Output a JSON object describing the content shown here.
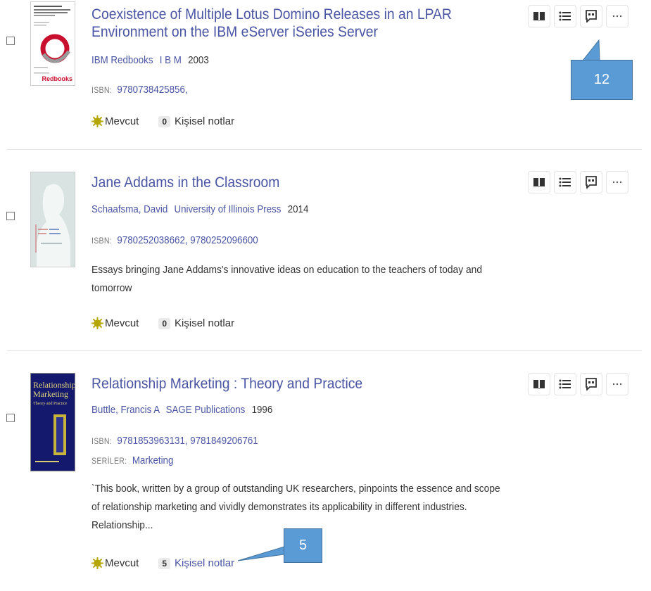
{
  "records": [
    {
      "title": "Coexistence of Multiple Lotus Domino Releases in an LPAR Environment on the IBM eServer iSeries Server",
      "author": "IBM Redbooks",
      "publisher": "I B M",
      "year": "2003",
      "isbn_label": "ISBN:",
      "isbn": "9780738425856,",
      "availability": "Mevcut",
      "notes_count": "0",
      "notes_label": "Kişisel notlar",
      "cover_text": "Redbooks"
    },
    {
      "title": "Jane Addams in the Classroom",
      "author": "Schaafsma, David",
      "publisher": "University of Illinois Press",
      "year": "2014",
      "isbn_label": "ISBN:",
      "isbn": "9780252038662, 9780252096600",
      "description": "Essays bringing Jane Addams's innovative ideas on education to the teachers of today and tomorrow",
      "availability": "Mevcut",
      "notes_count": "0",
      "notes_label": "Kişisel notlar"
    },
    {
      "title": "Relationship Marketing : Theory and Practice",
      "author": "Buttle, Francis A",
      "publisher": "SAGE Publications",
      "year": "1996",
      "isbn_label": "ISBN:",
      "isbn": "9781853963131, 9781849206761",
      "series_label": "SERİLER:",
      "series": "Marketing",
      "description": "`This book, written by a group of outstanding UK researchers, pinpoints the essence and scope of relationship marketing and vividly demonstrates its applicability in different industries. Relationship...",
      "availability": "Mevcut",
      "notes_count": "5",
      "notes_label": "Kişisel notlar",
      "cover_title": "Relationship Marketing",
      "cover_subtitle": "Theory and Practice"
    }
  ],
  "callouts": [
    {
      "label": "12"
    },
    {
      "label": "5"
    }
  ],
  "icons": [
    "book-icon",
    "list-icon",
    "quote-icon",
    "more-icon",
    "availability-icon"
  ],
  "colors": {
    "link": "#4a55a3",
    "callout_fill": "#5b9bd5",
    "callout_border": "#41719c",
    "available": "#b5a600"
  }
}
